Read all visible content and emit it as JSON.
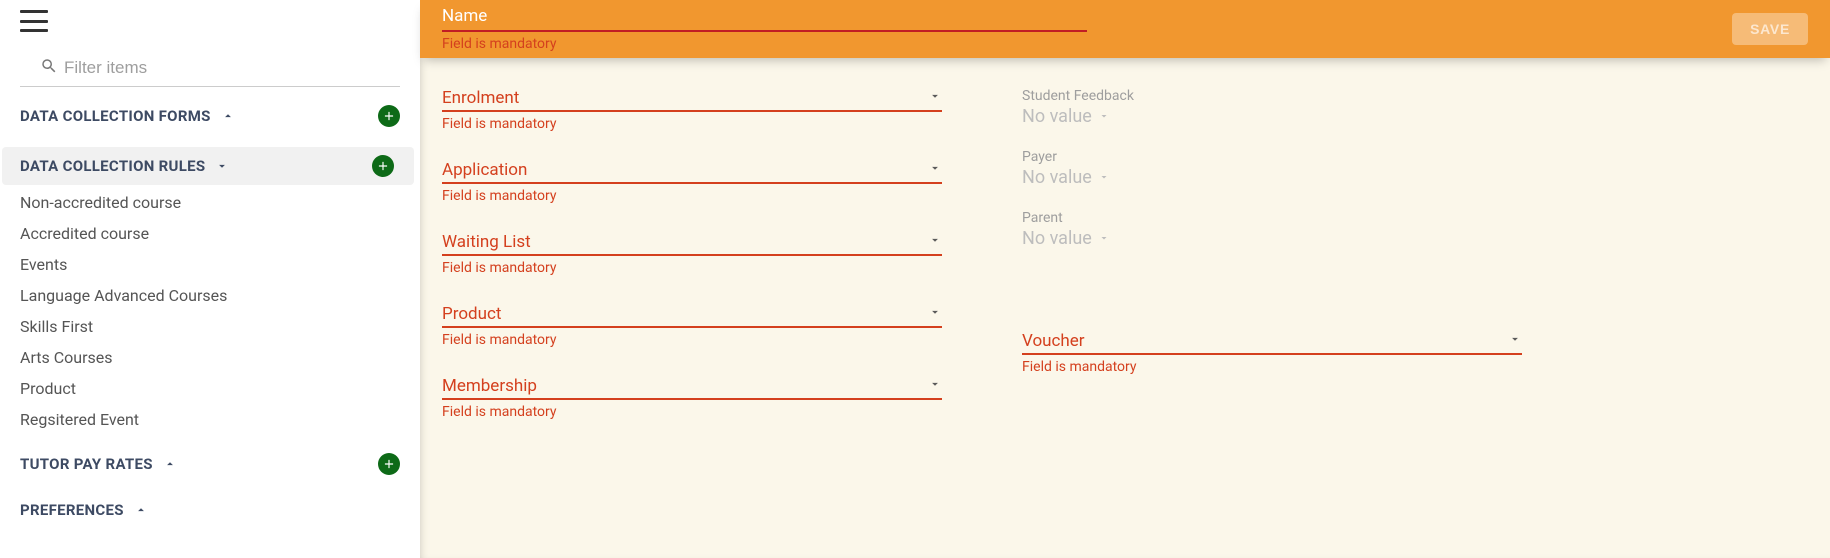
{
  "sidebar": {
    "search_placeholder": "Filter items",
    "sections": {
      "forms": {
        "title": "DATA COLLECTION FORMS"
      },
      "rules": {
        "title": "DATA COLLECTION RULES",
        "items": [
          "Non-accredited course",
          "Accredited course",
          "Events",
          "Language Advanced Courses",
          "Skills First",
          "Arts Courses",
          "Product",
          "Regsitered Event"
        ]
      },
      "tutor": {
        "title": "TUTOR PAY RATES"
      },
      "prefs": {
        "title": "PREFERENCES"
      }
    }
  },
  "header": {
    "name_label": "Name",
    "name_error": "Field is mandatory",
    "save_label": "SAVE"
  },
  "form": {
    "column1": [
      {
        "label": "Enrolment",
        "error": "Field is mandatory"
      },
      {
        "label": "Application",
        "error": "Field is mandatory"
      },
      {
        "label": "Waiting List",
        "error": "Field is mandatory"
      },
      {
        "label": "Product",
        "error": "Field is mandatory"
      },
      {
        "label": "Membership",
        "error": "Field is mandatory"
      }
    ],
    "column2_readonly": [
      {
        "label": "Student Feedback",
        "value": "No value"
      },
      {
        "label": "Payer",
        "value": "No value"
      },
      {
        "label": "Parent",
        "value": "No value"
      }
    ],
    "voucher": {
      "label": "Voucher",
      "error": "Field is mandatory"
    }
  }
}
